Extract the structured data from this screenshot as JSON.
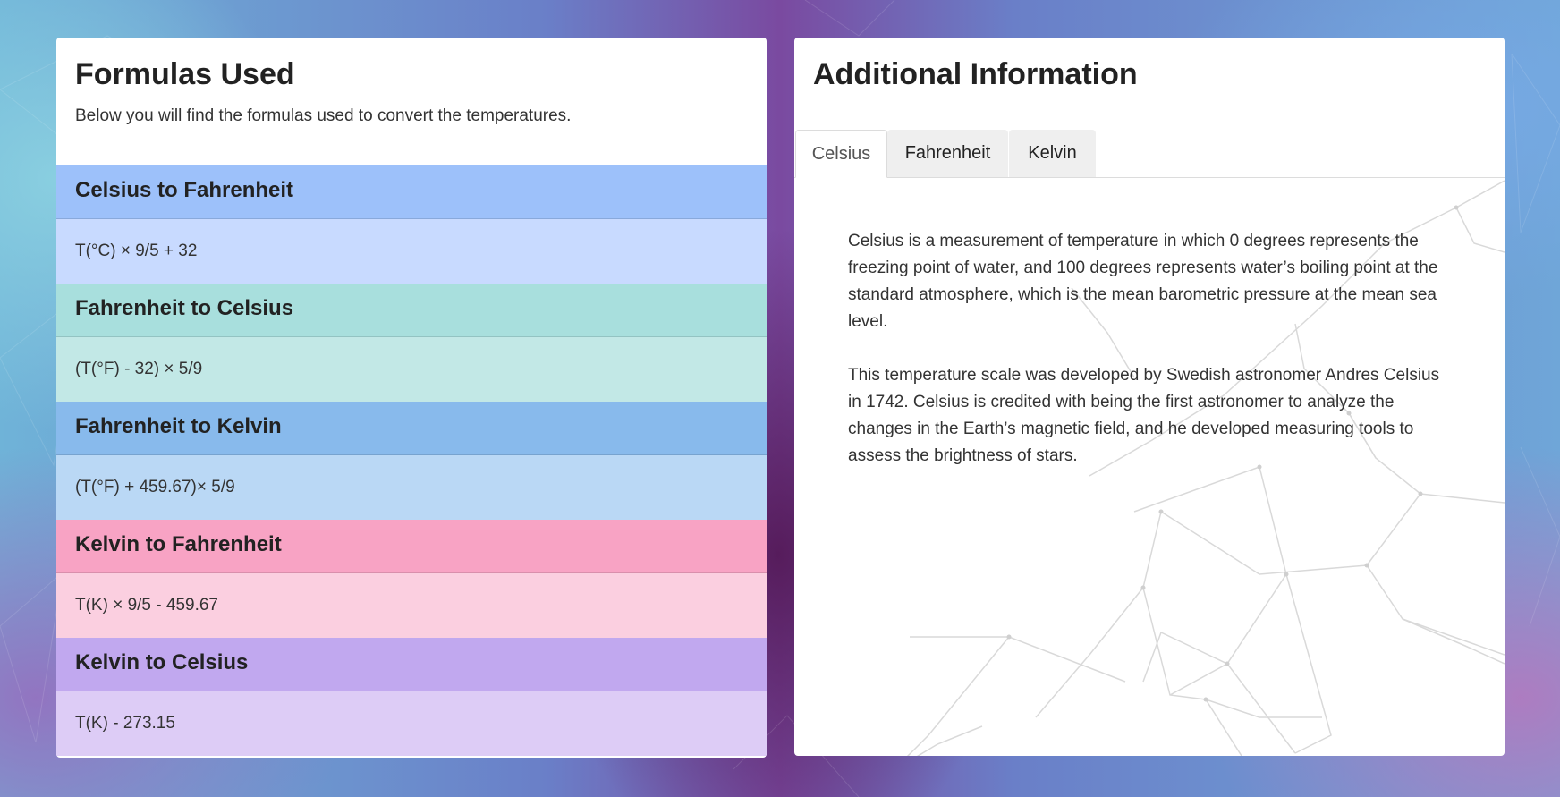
{
  "colors": {
    "head_1": "#9dc1fa",
    "body_1": "#c8daff",
    "head_2": "#a8dfdd",
    "body_2": "#c2e8e6",
    "head_3": "#88baec",
    "body_3": "#bad8f5",
    "head_4": "#f8a3c4",
    "body_4": "#fbcfe0",
    "head_5": "#c1a8ef",
    "body_5": "#ddccf6"
  },
  "formulas": {
    "title": "Formulas Used",
    "subtitle": "Below you will find the formulas used to convert the temperatures.",
    "items": [
      {
        "heading": "Celsius to Fahrenheit",
        "formula": "T(°C) × 9/5 + 32"
      },
      {
        "heading": "Fahrenheit to Celsius",
        "formula": "(T(°F) - 32) × 5/9"
      },
      {
        "heading": "Fahrenheit to Kelvin",
        "formula": "(T(°F) + 459.67)× 5/9"
      },
      {
        "heading": "Kelvin to Fahrenheit",
        "formula": "T(K) × 9/5 - 459.67"
      },
      {
        "heading": "Kelvin to Celsius",
        "formula": "T(K) - 273.15"
      }
    ]
  },
  "info": {
    "title": "Additional Information",
    "tabs": [
      {
        "label": "Celsius",
        "active": true
      },
      {
        "label": "Fahrenheit",
        "active": false
      },
      {
        "label": "Kelvin",
        "active": false
      }
    ],
    "paragraphs": [
      "Celsius is a measurement of temperature in which 0 degrees represents the freezing point of water, and 100 degrees represents water’s boiling point at the standard atmosphere, which is the mean barometric pressure at the mean sea level.",
      "This temperature scale was developed by Swedish astronomer Andres Celsius in 1742. Celsius is credited with being the first astronomer to analyze the changes in the Earth’s magnetic field, and he developed measuring tools to assess the brightness of stars."
    ]
  }
}
